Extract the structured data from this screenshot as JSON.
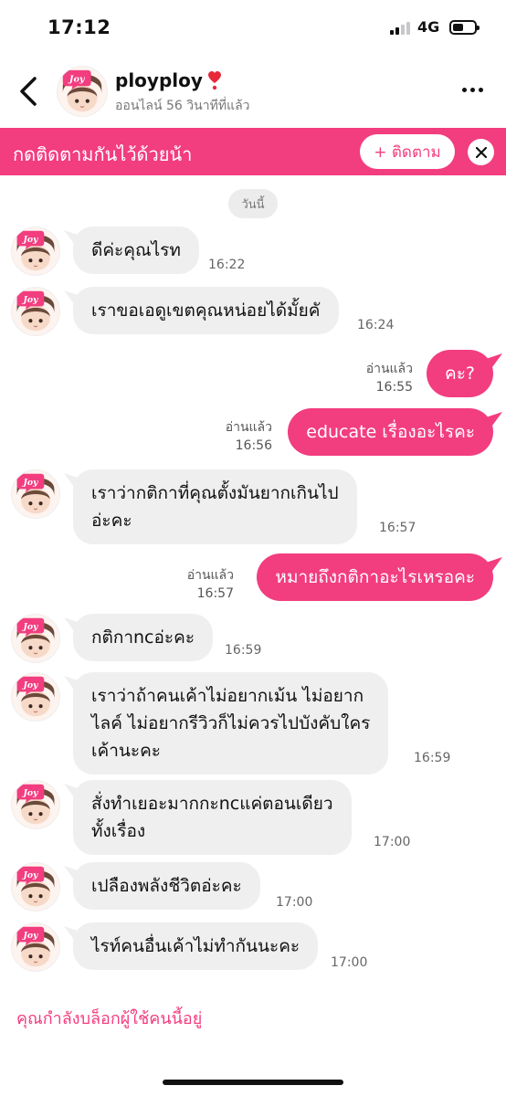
{
  "status": {
    "time": "17:12",
    "network": "4G",
    "battery_level": 0.5
  },
  "header": {
    "username": "ployploy",
    "presence": "ออนไลน์ 56 วินาทีที่แล้ว",
    "avatar_text": "Joy"
  },
  "banner": {
    "text": "กดติดตามกันไว้ด้วยน้า",
    "follow_label": "+ ติดตาม"
  },
  "chat": {
    "date_label": "วันนี้",
    "messages": [
      {
        "text": "ดีค่ะคุณไรท",
        "time": "16:22"
      },
      {
        "text": "เราขอเอดูเขตคุณหน่อยได้มั้ยคั",
        "time": "16:24"
      },
      {
        "text": "คะ?",
        "status": "อ่านแล้ว",
        "time": "16:55"
      },
      {
        "text": "educate เรื่องอะไรคะ",
        "status": "อ่านแล้ว",
        "time": "16:56"
      },
      {
        "lines": [
          "เราว่ากติกาที่คุณตั้งมันยากเกินไป",
          "อ่ะคะ"
        ],
        "time": "16:57"
      },
      {
        "text": "หมายถึงกติกาอะไรเหรอคะ",
        "status": "อ่านแล้ว",
        "time": "16:57"
      },
      {
        "text": "กติกาncอ่ะคะ",
        "time": "16:59"
      },
      {
        "lines": [
          "เราว่าถ้าคนเค้าไม่อยากเม้น ไม่อยาก",
          "ไลค์ ไม่อยากรีวิวก็ไม่ควรไปบังคับใคร",
          "เค้านะคะ"
        ],
        "time": "16:59"
      },
      {
        "lines": [
          "สั่งทำเยอะมากกะncแค่ตอนเดียว",
          "ทั้งเรื่อง"
        ],
        "time": "17:00"
      },
      {
        "text": "เปลืองพลังชีวิตอ่ะคะ",
        "time": "17:00"
      },
      {
        "text": "ไรท์คนอื่นเค้าไม่ทำกันนะคะ",
        "time": "17:00"
      }
    ]
  },
  "footer": {
    "blocked_text": "คุณกำลังบล็อกผู้ใช้คนนี้อยู่"
  },
  "colors": {
    "accent": "#f23d7f",
    "incoming_bubble": "#efefef",
    "secondary_text": "#777777"
  },
  "icons": {
    "back": "chevron-left-icon",
    "more": "more-dots-icon",
    "close": "close-icon",
    "heart": "heart-icon"
  }
}
